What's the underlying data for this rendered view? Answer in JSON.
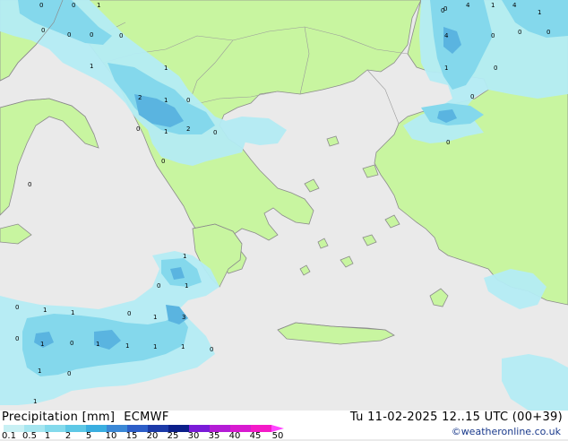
{
  "map": {
    "legend": {
      "title": "Precipitation [mm]",
      "model": "ECMWF",
      "scale_labels": [
        "0.1",
        "0.5",
        "1",
        "2",
        "5",
        "10",
        "15",
        "20",
        "25",
        "30",
        "35",
        "40",
        "45",
        "50"
      ],
      "scale_colors": [
        "#c8f0f4",
        "#a6e6f0",
        "#84daec",
        "#5ec8e6",
        "#3aaee0",
        "#3b88d6",
        "#2d5ec8",
        "#1c3aa8",
        "#0c1f8a",
        "#7a1bd8",
        "#b41cd6",
        "#d81ad0",
        "#f41ac8"
      ]
    },
    "valid_time": "Tu 11-02-2025 12..15 UTC (00+39)",
    "credit": "©weatheronline.co.uk",
    "colors": {
      "sea": "#eaeaea",
      "land": "#c8f5a0",
      "coast": "#8c8c8c",
      "border": "#9a9a9a",
      "light_precip": "#b4ecf4",
      "medium_precip": "#84d8ec",
      "heavy_precip": "#5ab4e0"
    },
    "amount_labels": [
      {
        "text": "4"
      },
      {
        "text": "1"
      },
      {
        "text": "0"
      },
      {
        "text": "0"
      },
      {
        "text": "0"
      },
      {
        "text": "1"
      },
      {
        "text": "1"
      },
      {
        "text": "0"
      },
      {
        "text": "2"
      },
      {
        "text": "1"
      },
      {
        "text": "0"
      },
      {
        "text": "0"
      },
      {
        "text": "1"
      },
      {
        "text": "2"
      },
      {
        "text": "0"
      },
      {
        "text": "0"
      },
      {
        "text": "0"
      },
      {
        "text": "4"
      },
      {
        "text": "1"
      },
      {
        "text": "0"
      },
      {
        "text": "0"
      },
      {
        "text": "0"
      },
      {
        "text": "0"
      },
      {
        "text": "0"
      },
      {
        "text": "4"
      },
      {
        "text": "1"
      },
      {
        "text": "1"
      },
      {
        "text": "0"
      },
      {
        "text": "0"
      },
      {
        "text": "0"
      },
      {
        "text": "0"
      },
      {
        "text": "1"
      },
      {
        "text": "1"
      },
      {
        "text": "0"
      },
      {
        "text": "0"
      },
      {
        "text": "1"
      },
      {
        "text": "1"
      },
      {
        "text": "0"
      },
      {
        "text": "1"
      },
      {
        "text": "3"
      },
      {
        "text": "0"
      },
      {
        "text": "1"
      },
      {
        "text": "0"
      },
      {
        "text": "1"
      },
      {
        "text": "1"
      },
      {
        "text": "1"
      },
      {
        "text": "1"
      },
      {
        "text": "1"
      },
      {
        "text": "0"
      },
      {
        "text": "0"
      },
      {
        "text": "1"
      },
      {
        "text": "0"
      }
    ]
  }
}
